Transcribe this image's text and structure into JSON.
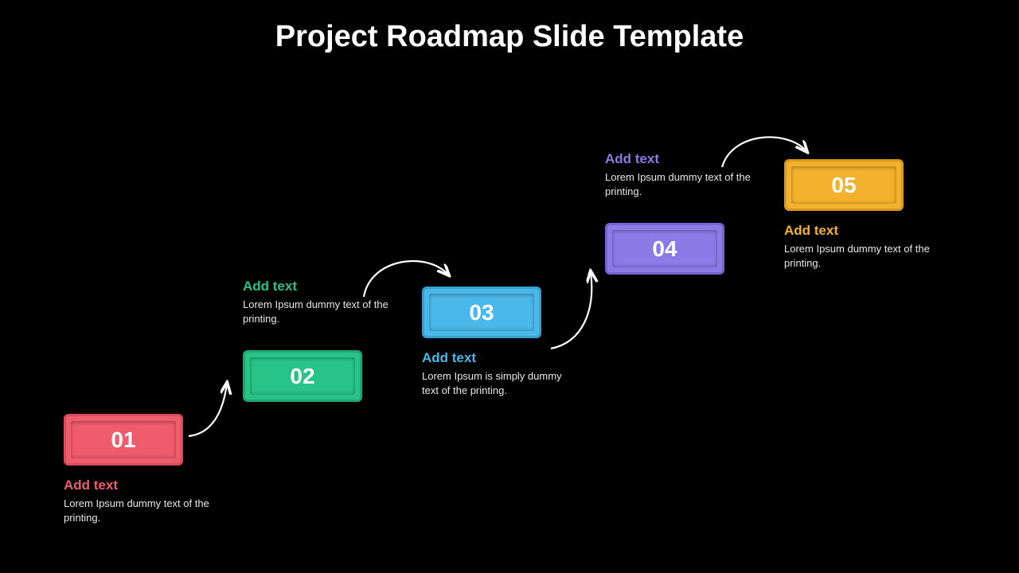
{
  "title": "Project Roadmap Slide Template",
  "steps": [
    {
      "num": "01",
      "heading": "Add text",
      "body": "Lorem Ipsum dummy text of the printing.",
      "color": "#ef5c6e"
    },
    {
      "num": "02",
      "heading": "Add text",
      "body": "Lorem Ipsum dummy text of the printing.",
      "color": "#28c487"
    },
    {
      "num": "03",
      "heading": "Add text",
      "body": "Lorem Ipsum is simply dummy text of the printing.",
      "color": "#4ab8e8"
    },
    {
      "num": "04",
      "heading": "Add text",
      "body": "Lorem Ipsum dummy text of the printing.",
      "color": "#8c7ae6"
    },
    {
      "num": "05",
      "heading": "Add text",
      "body": "Lorem Ipsum dummy text of the printing.",
      "color": "#f2b22d"
    }
  ]
}
